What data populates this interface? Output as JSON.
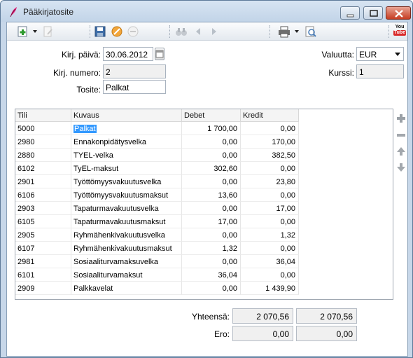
{
  "window": {
    "title": "Pääkirjatosite"
  },
  "form": {
    "date_label": "Kirj. päivä:",
    "date_value": "30.06.2012",
    "number_label": "Kirj. numero:",
    "number_value": "2",
    "voucher_label": "Tosite:",
    "voucher_value": "Palkat",
    "currency_label": "Valuutta:",
    "currency_value": "EUR",
    "rate_label": "Kurssi:",
    "rate_value": "1"
  },
  "table": {
    "headers": [
      "Tili",
      "Kuvaus",
      "Debet",
      "Kredit"
    ],
    "rows": [
      {
        "account": "5000",
        "desc": "Palkat",
        "debit": "1 700,00",
        "credit": "0,00"
      },
      {
        "account": "2980",
        "desc": "Ennakonpidätysvelka",
        "debit": "0,00",
        "credit": "170,00"
      },
      {
        "account": "2880",
        "desc": "TYEL-velka",
        "debit": "0,00",
        "credit": "382,50"
      },
      {
        "account": "6102",
        "desc": "TyEL-maksut",
        "debit": "302,60",
        "credit": "0,00"
      },
      {
        "account": "2901",
        "desc": "Työttömyysvakuutusvelka",
        "debit": "0,00",
        "credit": "23,80"
      },
      {
        "account": "6106",
        "desc": "Työttömyysvakuutusmaksut",
        "debit": "13,60",
        "credit": "0,00"
      },
      {
        "account": "2903",
        "desc": "Tapaturmavakuutusvelka",
        "debit": "0,00",
        "credit": "17,00"
      },
      {
        "account": "6105",
        "desc": "Tapaturmavakuutusmaksut",
        "debit": "17,00",
        "credit": "0,00"
      },
      {
        "account": "2905",
        "desc": "Ryhmähenkivakuutusvelka",
        "debit": "0,00",
        "credit": "1,32"
      },
      {
        "account": "6107",
        "desc": "Ryhmähenkivakuutusmaksut",
        "debit": "1,32",
        "credit": "0,00"
      },
      {
        "account": "2981",
        "desc": "Sosiaaliturvamaksuvelka",
        "debit": "0,00",
        "credit": "36,04"
      },
      {
        "account": "6101",
        "desc": "Sosiaaliturvamaksut",
        "debit": "36,04",
        "credit": "0,00"
      },
      {
        "account": "2909",
        "desc": "Palkkavelat",
        "debit": "0,00",
        "credit": "1 439,90"
      }
    ]
  },
  "totals": {
    "total_label": "Yhteensä:",
    "total_debit": "2 070,56",
    "total_credit": "2 070,56",
    "diff_label": "Ero:",
    "diff_debit": "0,00",
    "diff_credit": "0,00"
  },
  "toolbar": {
    "youtube_label": "You Tube"
  },
  "colors": {
    "selection": "#3399ff",
    "close_button": "#c63d22",
    "window_frame": "#c7d7e9"
  }
}
